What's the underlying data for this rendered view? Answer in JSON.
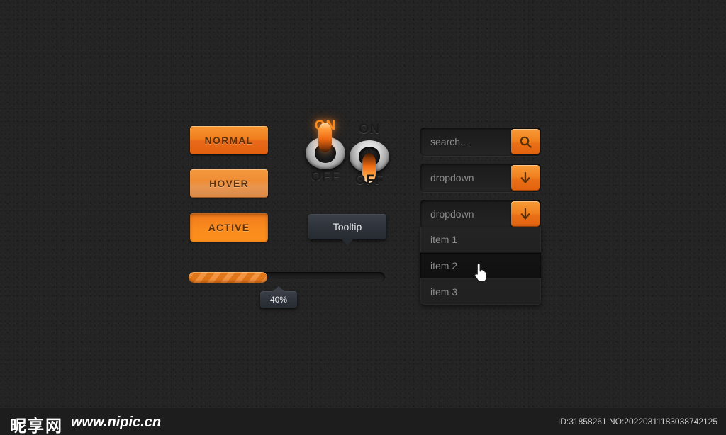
{
  "buttons": [
    {
      "label": "NORMAL",
      "state": "normal"
    },
    {
      "label": "HOVER",
      "state": "hover"
    },
    {
      "label": "ACTIVE",
      "state": "active"
    }
  ],
  "switches": {
    "left": {
      "on_label": "ON",
      "off_label": "OFF",
      "state": "on",
      "lit_color": "#ff8a1e"
    },
    "right": {
      "on_label": "ON",
      "off_label": "OFF",
      "state": "off",
      "lit_color": "#ff8a1e"
    }
  },
  "tooltip": {
    "label": "Tooltip"
  },
  "progress": {
    "percent": 40,
    "value_label": "40%",
    "fill_color": "#f0801c"
  },
  "search": {
    "placeholder": "search...",
    "value": "search...",
    "button_icon": "search-icon"
  },
  "dropdown_closed": {
    "value": "dropdown",
    "button_icon": "arrow-down-icon"
  },
  "dropdown_open": {
    "value": "dropdown",
    "button_icon": "arrow-down-icon",
    "items": [
      {
        "label": "item 1",
        "highlighted": false
      },
      {
        "label": "item 2",
        "highlighted": true
      },
      {
        "label": "item 3",
        "highlighted": false
      }
    ]
  },
  "cursor": {
    "type": "pointing-hand-cursor"
  },
  "footer": {
    "watermark_cn": "昵享网",
    "watermark_url": "www.nipic.cn",
    "id_text": "ID:31858261 NO:20220311183038742125"
  },
  "theme": {
    "background": "#242424",
    "accent": "#f0801c",
    "field_bg": "#202020"
  }
}
